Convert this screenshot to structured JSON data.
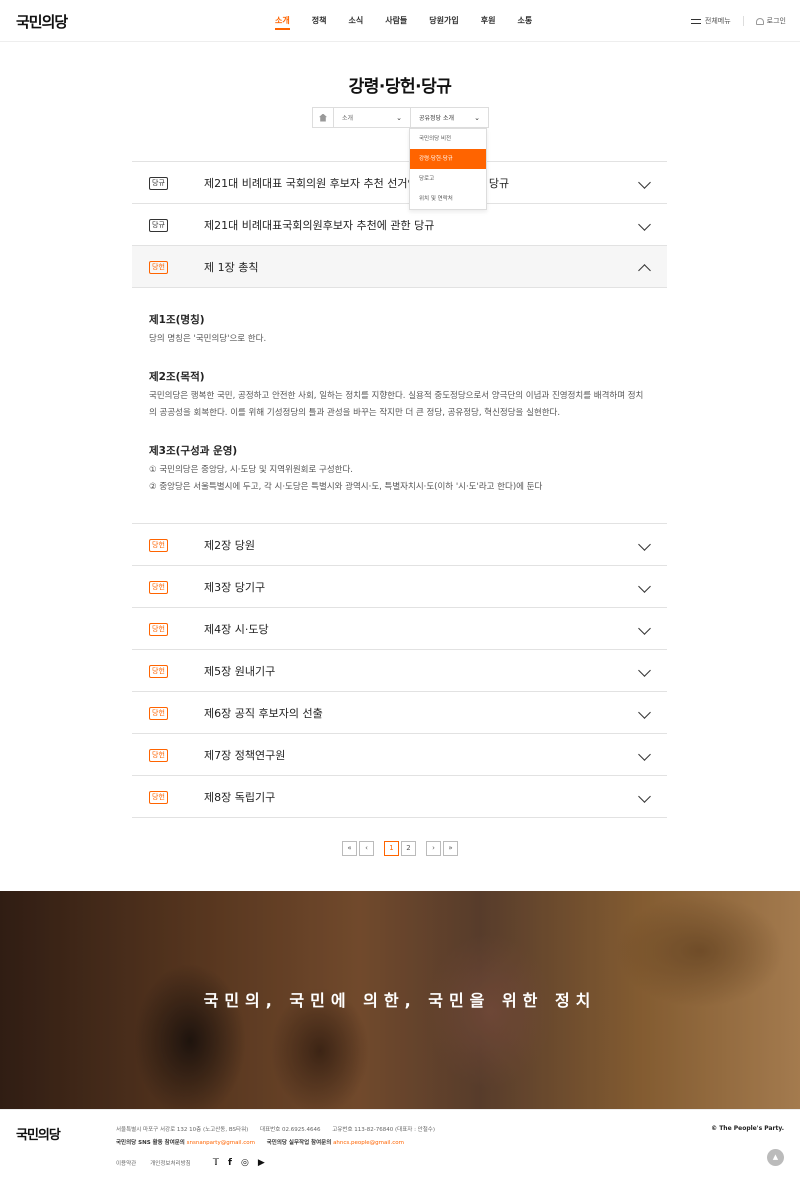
{
  "header": {
    "logo": "국민의당",
    "nav": [
      "소개",
      "정책",
      "소식",
      "사람들",
      "당원가입",
      "후원",
      "소통"
    ],
    "all_menu": "전체메뉴",
    "login": "로그인"
  },
  "page": {
    "title": "강령·당헌·당규",
    "breadcrumb": {
      "level1": "소개",
      "level2": "공유정당 소개"
    },
    "dropdown": [
      "국민의당 비전",
      "강령·당헌·당규",
      "당로고",
      "위치 및 연락처"
    ]
  },
  "accordion": {
    "rows_top": [
      {
        "badge": "당규",
        "title": "제21대 비례대표 국회의원 후보자 추천 선거인단 구성에 관한 당규"
      },
      {
        "badge": "당규",
        "title": "제21대 비례대표국회의원후보자 추천에 관한 당규"
      }
    ],
    "open_row": {
      "badge": "당헌",
      "title": "제 1장 총칙"
    },
    "articles": [
      {
        "title": "제1조(명칭)",
        "body": "당의 명칭은 '국민의당'으로 한다."
      },
      {
        "title": "제2조(목적)",
        "body": "국민의당은 행복한 국민, 공정하고 안전한 사회, 일하는 정치를 지향한다. 실용적 중도정당으로서 양극단의 이념과 진영정치를 배격하며 정치의 공공성을 회복한다. 이를 위해 기성정당의 틀과 관성을 바꾸는 작지만 더 큰 정당, 공유정당, 혁신정당을 실현한다."
      },
      {
        "title": "제3조(구성과 운영)",
        "line1": "① 국민의당은 중앙당, 시·도당 및 지역위원회로 구성한다.",
        "line2": "② 중앙당은 서울특별시에 두고, 각 시·도당은 특별시와 광역시·도, 특별자치시·도(이하 '시·도'라고 한다)에 둔다"
      }
    ],
    "rows_bottom": [
      {
        "badge": "당헌",
        "title": "제2장 당원"
      },
      {
        "badge": "당헌",
        "title": "제3장 당기구"
      },
      {
        "badge": "당헌",
        "title": "제4장 시·도당"
      },
      {
        "badge": "당헌",
        "title": "제5장 원내기구"
      },
      {
        "badge": "당헌",
        "title": "제6장 공직 후보자의 선출"
      },
      {
        "badge": "당헌",
        "title": "제7장 정책연구원"
      },
      {
        "badge": "당헌",
        "title": "제8장 독립기구"
      }
    ]
  },
  "pagination": {
    "first": "«",
    "prev": "‹",
    "pages": [
      "1",
      "2"
    ],
    "current": "1",
    "next": "›",
    "last": "»"
  },
  "banner": {
    "slogan": "국민의, 국민에 의한, 국민을 위한 정치"
  },
  "footer": {
    "logo": "국민의당",
    "address": "서울특별시 마포구 서강로 132 10층 (노고산동, BS타워)",
    "phone_label": "대표번호",
    "phone": "02.6925.4646",
    "bizno_label": "고유번호",
    "bizno": "113-82-76840 (대표자 : 안철수)",
    "sns_label": "국민의당 SNS 활동 참여문의",
    "sns_email": "snsnanparty@gmail.com",
    "work_label": "국민의당 실무작업 참여문의",
    "work_email": "ahncs.people@gmail.com",
    "copyright": "© The People's Party.",
    "links": [
      "이용약관",
      "개인정보처리방침"
    ],
    "sns_icons": [
      "twitter-icon",
      "facebook-icon",
      "instagram-icon",
      "youtube-icon"
    ],
    "top": "▲"
  },
  "colors": {
    "accent": "#ff6400",
    "text": "#222222",
    "border": "#e2e2e2"
  }
}
